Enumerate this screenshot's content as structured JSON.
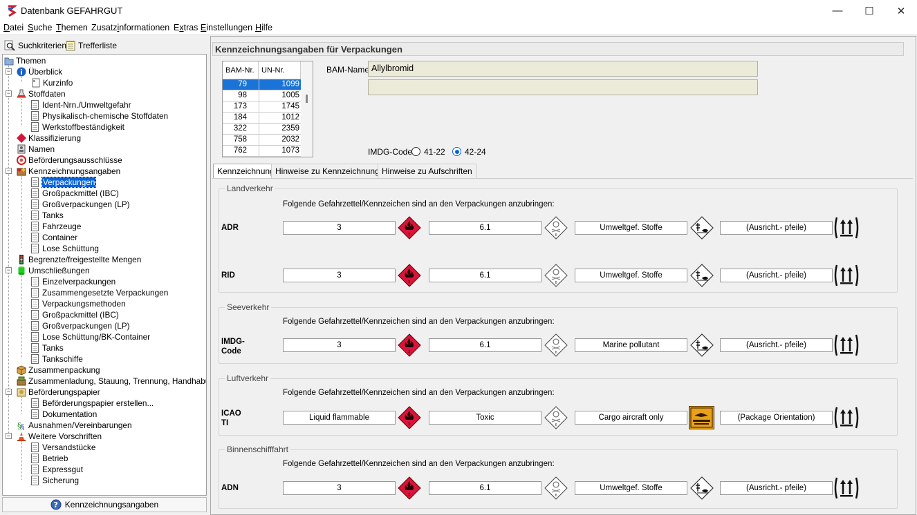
{
  "window": {
    "title": "Datenbank GEFAHRGUT",
    "controls": {
      "minimize": "—",
      "maximize": "☐",
      "close": "✕"
    }
  },
  "menu": [
    {
      "pre": "",
      "u": "D",
      "post": "atei"
    },
    {
      "pre": "",
      "u": "S",
      "post": "uche"
    },
    {
      "pre": "",
      "u": "T",
      "post": "hemen"
    },
    {
      "pre": "Zusatz",
      "u": "i",
      "post": "nformationen"
    },
    {
      "pre": "E",
      "u": "x",
      "post": "tras"
    },
    {
      "pre": "",
      "u": "E",
      "post": "instellungen"
    },
    {
      "pre": "",
      "u": "H",
      "post": "ilfe"
    }
  ],
  "left_tabs": {
    "search": "Suchkriterien",
    "results": "Trefferliste"
  },
  "tree": {
    "root": "Themen",
    "ueberblick": "Überblick",
    "kurzinfo": "Kurzinfo",
    "stoffdaten": "Stoffdaten",
    "ident": "Ident-Nrn./Umweltgefahr",
    "physchem": "Physikalisch-chemische Stoffdaten",
    "werkstoff": "Werkstoffbeständigkeit",
    "klassifizierung": "Klassifizierung",
    "namen": "Namen",
    "befausschluesse": "Beförderungsausschlüsse",
    "kennzeichnungsangaben": "Kennzeichnungsangaben",
    "verpackungen": "Verpackungen",
    "ibc": "Großpackmittel (IBC)",
    "lp": "Großverpackungen (LP)",
    "tanks": "Tanks",
    "fahrzeuge": "Fahrzeuge",
    "container": "Container",
    "lose": "Lose Schüttung",
    "begrenzte": "Begrenzte/freigestellte Mengen",
    "umschliessungen": "Umschließungen",
    "einzel": "Einzelverpackungen",
    "zusammengesetzt": "Zusammengesetzte Verpackungen",
    "methoden": "Verpackungsmethoden",
    "ibc2": "Großpackmittel (IBC)",
    "lp2": "Großverpackungen (LP)",
    "lose_bk": "Lose Schüttung/BK-Container",
    "tanks2": "Tanks",
    "tankschiffe": "Tankschiffe",
    "zusammenpackung": "Zusammenpackung",
    "zusammenladung": "Zusammenladung, Stauung, Trennung, Handhabung",
    "befpapier": "Beförderungspapier",
    "befpapier_erstellen": "Beförderungspapier erstellen...",
    "dokumentation": "Dokumentation",
    "ausnahmen": "Ausnahmen/Vereinbarungen",
    "weitere": "Weitere Vorschriften",
    "versandstuecke": "Versandstücke",
    "betrieb": "Betrieb",
    "expressgut": "Expressgut",
    "sicherung": "Sicherung"
  },
  "left_bottom": "Kennzeichnungsangaben",
  "section_title": "Kennzeichnungsangaben für Verpackungen",
  "bam_table": {
    "headers": [
      "BAM-Nr.",
      "UN-Nr."
    ],
    "rows": [
      [
        "79",
        "1099"
      ],
      [
        "98",
        "1005"
      ],
      [
        "173",
        "1745"
      ],
      [
        "184",
        "1012"
      ],
      [
        "322",
        "2359"
      ],
      [
        "758",
        "2032"
      ],
      [
        "762",
        "1073"
      ]
    ]
  },
  "bam_name": {
    "label": "BAM-Name:",
    "value": "Allylbromid",
    "value2": ""
  },
  "imdg": {
    "label": "IMDG-Code",
    "opt1": "41-22",
    "opt2": "42-24",
    "selected": "42-24"
  },
  "tabs": [
    "Kennzeichnung",
    "Hinweise zu Kennzeichnungen",
    "Hinweise zu Aufschriften"
  ],
  "note": "Folgende Gefahrzettel/Kennzeichen sind an den Verpackungen anzubringen:",
  "groups": {
    "land": "Landverkehr",
    "see": "Seeverkehr",
    "luft": "Luftverkehr",
    "binnen": "Binnenschifffahrt"
  },
  "rows": {
    "adr": {
      "l1": "ADR",
      "l2": "",
      "c1": "3",
      "c2": "6.1",
      "c3": "Umweltgef. Stoffe",
      "c4": "(Ausricht.- pfeile)"
    },
    "rid": {
      "l1": "RID",
      "l2": "",
      "c1": "3",
      "c2": "6.1",
      "c3": "Umweltgef. Stoffe",
      "c4": "(Ausricht.- pfeile)"
    },
    "imdg": {
      "l1": "IMDG-",
      "l2": "Code",
      "c1": "3",
      "c2": "6.1",
      "c3": "Marine pollutant",
      "c4": "(Ausricht.- pfeile)"
    },
    "icao": {
      "l1": "ICAO",
      "l2": "TI",
      "c1": "Liquid flammable",
      "c2": "Toxic",
      "c3": "Cargo aircraft only",
      "c4": "(Package Orientation)"
    },
    "adn": {
      "l1": "ADN",
      "l2": "",
      "c1": "3",
      "c2": "6.1",
      "c3": "Umweltgef. Stoffe",
      "c4": "(Ausricht.- pfeile)"
    }
  },
  "colors": {
    "flammable_red": "#d8143a",
    "selection_blue": "#0a64d7",
    "cao_orange": "#e8a21a"
  },
  "icons": [
    "app-logo-icon",
    "search-icon",
    "notepad-icon",
    "info-icon",
    "flask-icon",
    "diamond-red-icon",
    "name-tag-icon",
    "forbidden-icon",
    "warning-label-icon",
    "traffic-light-icon",
    "green-drum-icon",
    "box-icon",
    "package-icon",
    "document-icon",
    "paragraph-icon",
    "cone-icon",
    "help-icon",
    "flame-diamond-icon",
    "skull-diamond-icon",
    "environment-diamond-icon",
    "cargo-aircraft-only-icon",
    "orientation-arrows-icon"
  ]
}
